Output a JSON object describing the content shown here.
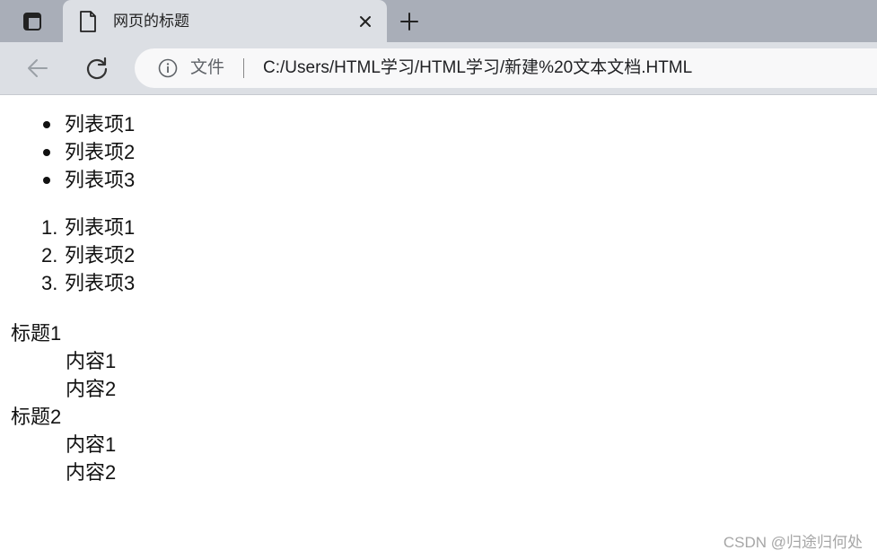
{
  "browser": {
    "tab": {
      "title": "网页的标题"
    },
    "address_bar": {
      "scheme_label": "文件",
      "url": "C:/Users/HTML学习/HTML学习/新建%20文本文档.HTML"
    }
  },
  "page": {
    "unordered_list": [
      "列表项1",
      "列表项2",
      "列表项3"
    ],
    "ordered_list": [
      "列表项1",
      "列表项2",
      "列表项3"
    ],
    "ordered_numbers": [
      "1.",
      "2.",
      "3."
    ],
    "definition_list": [
      {
        "term": "标题1",
        "details": [
          "内容1",
          "内容2"
        ]
      },
      {
        "term": "标题2",
        "details": [
          "内容1",
          "内容2"
        ]
      }
    ]
  },
  "watermark": "CSDN @归途归何处",
  "colors": {
    "tabstrip": "#a9aeb8",
    "toolbar": "#dcdfe4",
    "address_bar": "#f8f8f9"
  },
  "icons": [
    "tab-actions-icon",
    "page-icon",
    "close-icon",
    "plus-icon",
    "back-arrow-icon",
    "reload-icon",
    "info-icon"
  ]
}
